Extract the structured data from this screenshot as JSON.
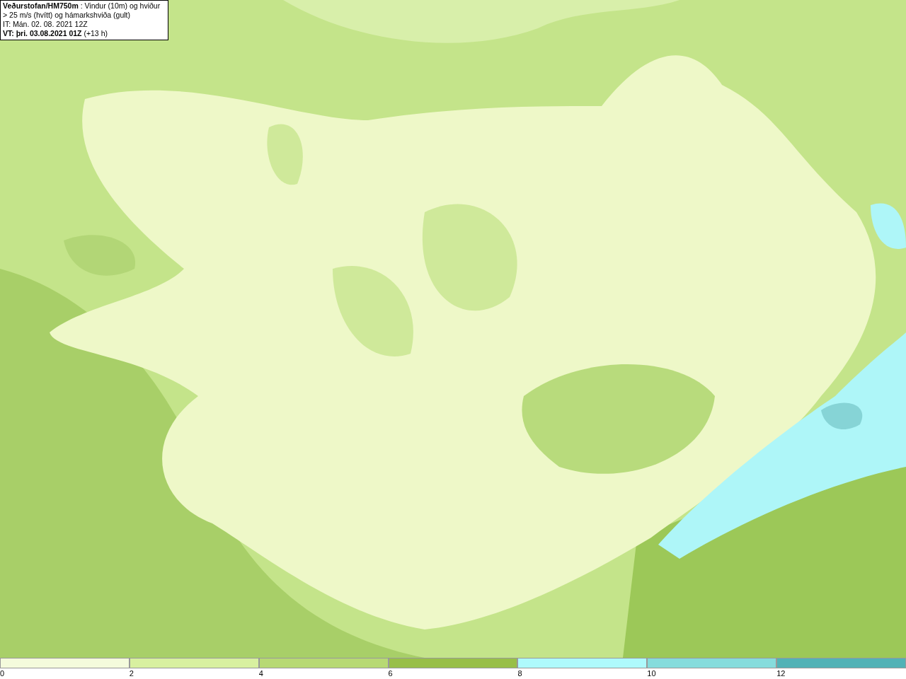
{
  "title_box": {
    "heading": "**Veðurstofan/HM750m** : Vindur (10m) og hviður > 25 m/s (hvítt) og hámarkshviða (gult)",
    "issue_time": "IT: Mán. 02. 08. 2021 12Z",
    "valid_time": "**VT: þri. 03.08.2021 01Z** (+13 h)"
  },
  "legend": [
    {
      "label": "0",
      "color": "#f4fbdc"
    },
    {
      "label": "2",
      "color": "#d8f0a0"
    },
    {
      "label": "4",
      "color": "#b7d974"
    },
    {
      "label": "6",
      "color": "#98bf48"
    },
    {
      "label": "8",
      "color": "#aefafc"
    },
    {
      "label": "10",
      "color": "#86dcdc"
    },
    {
      "label": "12",
      "color": "#52b2b6"
    }
  ]
}
